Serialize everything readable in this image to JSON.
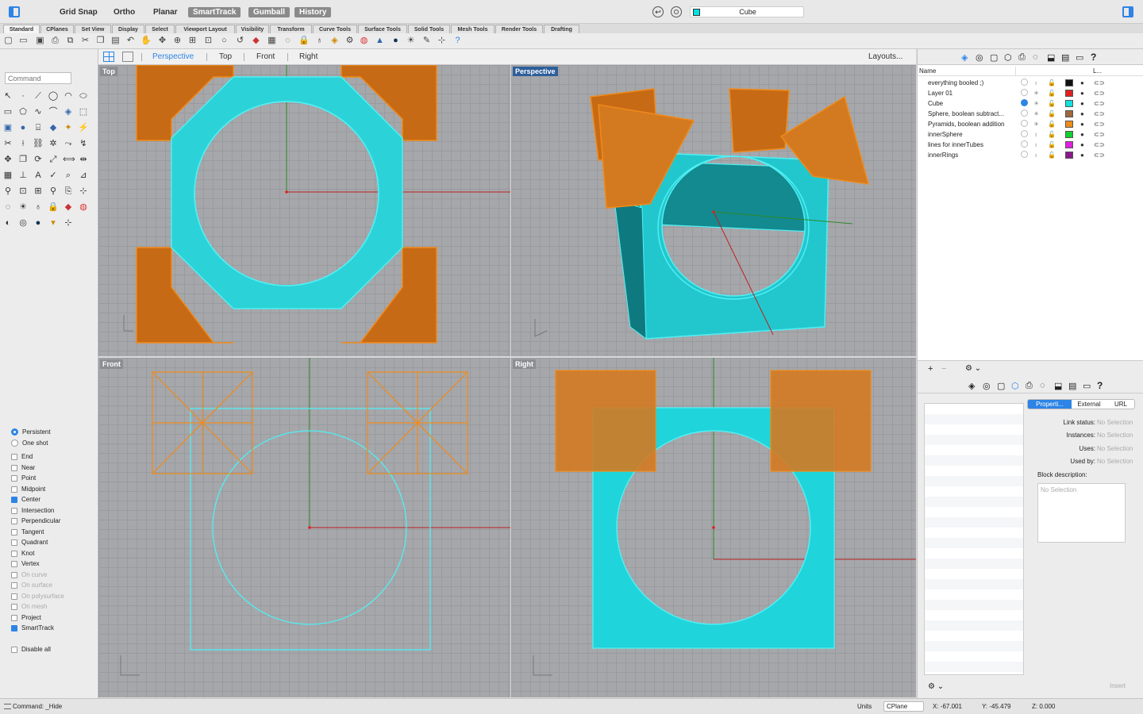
{
  "toolbar": {
    "grid_snap": "Grid Snap",
    "ortho": "Ortho",
    "planar": "Planar",
    "smarttrack": "SmartTrack",
    "gumball": "Gumball",
    "history": "History",
    "layer_name": "Cube",
    "layer_color": "#00e0e0"
  },
  "tabs": [
    "Standard",
    "CPlanes",
    "Set View",
    "Display",
    "Select",
    "Viewport Layout",
    "Visibility",
    "Transform",
    "Curve Tools",
    "Surface Tools",
    "Solid Tools",
    "Mesh Tools",
    "Render Tools",
    "Drafting"
  ],
  "command": {
    "placeholder": "Command",
    "last": "Command: _Hide"
  },
  "viewport_header": {
    "tabs": [
      "Perspective",
      "Top",
      "Front",
      "Right"
    ],
    "active": "Perspective",
    "layouts": "Layouts..."
  },
  "viewports": {
    "top": "Top",
    "perspective": "Perspective",
    "front": "Front",
    "right": "Right"
  },
  "osnaps": [
    {
      "label": "Persistent",
      "type": "radio",
      "on": true
    },
    {
      "label": "One shot",
      "type": "radio",
      "on": false
    },
    {
      "label": "End",
      "type": "check",
      "on": false
    },
    {
      "label": "Near",
      "type": "check",
      "on": false
    },
    {
      "label": "Point",
      "type": "check",
      "on": false
    },
    {
      "label": "Midpoint",
      "type": "check",
      "on": false
    },
    {
      "label": "Center",
      "type": "check",
      "on": true
    },
    {
      "label": "Intersection",
      "type": "check",
      "on": false
    },
    {
      "label": "Perpendicular",
      "type": "check",
      "on": false
    },
    {
      "label": "Tangent",
      "type": "check",
      "on": false
    },
    {
      "label": "Quadrant",
      "type": "check",
      "on": false
    },
    {
      "label": "Knot",
      "type": "check",
      "on": false
    },
    {
      "label": "Vertex",
      "type": "check",
      "on": false
    },
    {
      "label": "On curve",
      "type": "check",
      "on": false,
      "dim": true
    },
    {
      "label": "On surface",
      "type": "check",
      "on": false,
      "dim": true
    },
    {
      "label": "On polysurface",
      "type": "check",
      "on": false,
      "dim": true
    },
    {
      "label": "On mesh",
      "type": "check",
      "on": false,
      "dim": true
    },
    {
      "label": "Project",
      "type": "check",
      "on": false
    },
    {
      "label": "SmartTrack",
      "type": "check",
      "on": true
    },
    {
      "label": "Disable all",
      "type": "check",
      "on": false
    }
  ],
  "layers": {
    "col_name": "Name",
    "col_l": "L...",
    "rows": [
      {
        "name": "everything booled ;)",
        "color": "#111111",
        "current": false
      },
      {
        "name": "Layer 01",
        "color": "#e02020",
        "current": false
      },
      {
        "name": "Cube",
        "color": "#10e0e0",
        "current": true
      },
      {
        "name": "Sphere, boolean subtract...",
        "color": "#a0683a",
        "current": false
      },
      {
        "name": "Pyramids, boolean addition",
        "color": "#f08a1a",
        "current": false
      },
      {
        "name": "innerSphere",
        "color": "#10d030",
        "current": false
      },
      {
        "name": "lines for innerTubes",
        "color": "#e020e0",
        "current": false
      },
      {
        "name": "innerRings",
        "color": "#8a1a8a",
        "current": false
      }
    ]
  },
  "properties": {
    "tabs": [
      "Properti...",
      "External",
      "URL"
    ],
    "fields": [
      {
        "label": "Link status:",
        "value": "No Selection"
      },
      {
        "label": "Instances:",
        "value": "No Selection"
      },
      {
        "label": "Uses:",
        "value": "No Selection"
      },
      {
        "label": "Used by:",
        "value": "No Selection"
      }
    ],
    "block_description": "Block description:",
    "description_placeholder": "No Selection",
    "insert": "Insert"
  },
  "status": {
    "units": "Units",
    "cplane": "CPlane",
    "x": "X: -67.001",
    "y": "Y: -45.479",
    "z": "Z: 0.000"
  }
}
